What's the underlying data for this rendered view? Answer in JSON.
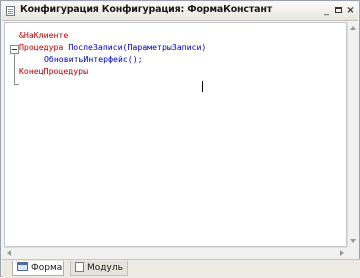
{
  "window": {
    "title": "Конфигурация Конфигурация: ФормаКонстант",
    "buttons": {
      "minimize": "_",
      "maximize": "□",
      "close": "×"
    }
  },
  "code": {
    "directive": "&НаКлиенте",
    "line2_keyword": "Процедура",
    "line2_name": "ПослеЗаписи(ПараметрыЗаписи)",
    "line3_call": "ОбновитьИнтерфейс();",
    "line4_keyword": "КонецПроцедуры"
  },
  "tabs": [
    {
      "label": "Форма",
      "icon": "form-icon",
      "active": true
    },
    {
      "label": "Модуль",
      "icon": "module-icon",
      "active": false
    }
  ],
  "colors": {
    "keyword": "#c00000",
    "identifier": "#0000cc"
  }
}
